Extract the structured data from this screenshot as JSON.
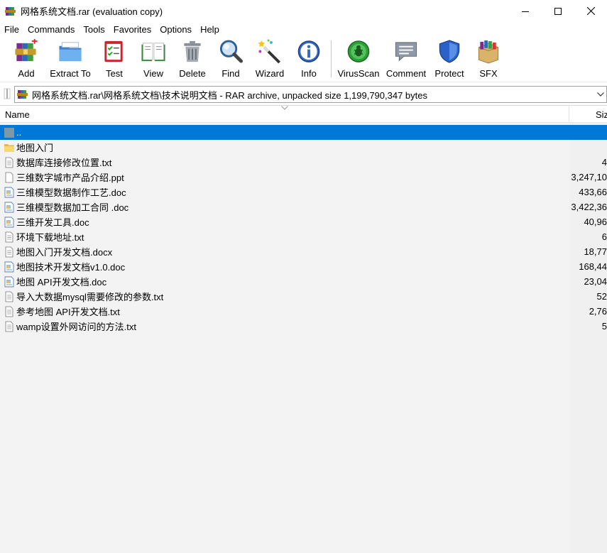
{
  "window": {
    "title": "网格系统文档.rar (evaluation copy)"
  },
  "menu": [
    "File",
    "Commands",
    "Tools",
    "Favorites",
    "Options",
    "Help"
  ],
  "toolbar": [
    {
      "label": "Add",
      "icon": "add-icon"
    },
    {
      "label": "Extract To",
      "icon": "extract-to-icon"
    },
    {
      "label": "Test",
      "icon": "test-icon"
    },
    {
      "label": "View",
      "icon": "view-icon"
    },
    {
      "label": "Delete",
      "icon": "delete-icon"
    },
    {
      "label": "Find",
      "icon": "find-icon"
    },
    {
      "label": "Wizard",
      "icon": "wizard-icon"
    },
    {
      "label": "Info",
      "icon": "info-icon"
    },
    {
      "label": "VirusScan",
      "icon": "virusscan-icon"
    },
    {
      "label": "Comment",
      "icon": "comment-icon"
    },
    {
      "label": "Protect",
      "icon": "protect-icon"
    },
    {
      "label": "SFX",
      "icon": "sfx-icon"
    }
  ],
  "address": {
    "path": "网格系统文档.rar\\网格系统文档\\技术说明文档 - RAR archive, unpacked size 1,199,790,347 bytes"
  },
  "columns": {
    "name": "Name",
    "size": "Siz"
  },
  "files": [
    {
      "name": "..",
      "size": "",
      "type": "up"
    },
    {
      "name": "地图入门",
      "size": "",
      "type": "folder"
    },
    {
      "name": "数据库连接修改位置.txt",
      "size": "4",
      "type": "txt"
    },
    {
      "name": "三维数字城市产品介绍.ppt",
      "size": "3,247,10",
      "type": "ppt"
    },
    {
      "name": "三维模型数据制作工艺.doc",
      "size": "433,66",
      "type": "doc"
    },
    {
      "name": "三维模型数据加工合同 .doc",
      "size": "3,422,36",
      "type": "doc"
    },
    {
      "name": "三维开发工具.doc",
      "size": "40,96",
      "type": "doc"
    },
    {
      "name": "环境下载地址.txt",
      "size": "6",
      "type": "txt"
    },
    {
      "name": "地图入门开发文档.docx",
      "size": "18,77",
      "type": "txt"
    },
    {
      "name": "地图技术开发文档v1.0.doc",
      "size": "168,44",
      "type": "doc"
    },
    {
      "name": "地图 API开发文档.doc",
      "size": "23,04",
      "type": "doc"
    },
    {
      "name": "导入大数据mysql需要修改的参数.txt",
      "size": "52",
      "type": "txt"
    },
    {
      "name": "参考地图 API开发文档.txt",
      "size": "2,76",
      "type": "txt"
    },
    {
      "name": "wamp设置外网访问的方法.txt",
      "size": "5",
      "type": "txt"
    }
  ],
  "colors": {
    "selection": "#0078d7",
    "list_bg": "#f0f0f0"
  }
}
